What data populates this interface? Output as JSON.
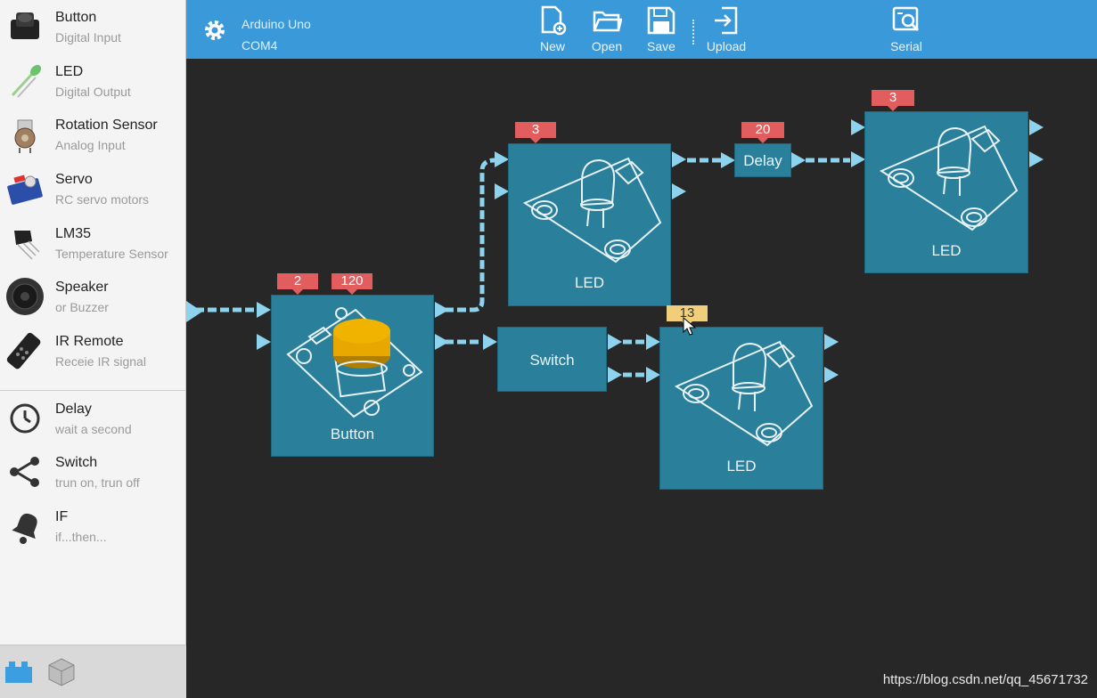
{
  "sidebar": {
    "items": [
      {
        "name": "Button",
        "desc": "Digital Input",
        "icon": "button-component-icon"
      },
      {
        "name": "LED",
        "desc": "Digital Output",
        "icon": "led-component-icon"
      },
      {
        "name": "Rotation Sensor",
        "desc": "Analog Input",
        "icon": "potentiometer-icon"
      },
      {
        "name": "Servo",
        "desc": "RC servo motors",
        "icon": "servo-icon"
      },
      {
        "name": "LM35",
        "desc": "Temperature Sensor",
        "icon": "lm35-icon"
      },
      {
        "name": "Speaker",
        "desc": "or Buzzer",
        "icon": "speaker-icon"
      },
      {
        "name": "IR Remote",
        "desc": "Receie IR signal",
        "icon": "ir-remote-icon"
      }
    ],
    "logic_items": [
      {
        "name": "Delay",
        "desc": "wait a second",
        "icon": "clock-icon"
      },
      {
        "name": "Switch",
        "desc": "trun on, trun off",
        "icon": "share-icon"
      },
      {
        "name": "IF",
        "desc": "if...then...",
        "icon": "bell-icon"
      }
    ],
    "bottom_tabs": [
      "blocks-icon",
      "cube-icon"
    ]
  },
  "toolbar": {
    "board": "Arduino Uno",
    "port": "COM4",
    "new_label": "New",
    "open_label": "Open",
    "save_label": "Save",
    "upload_label": "Upload",
    "serial_label": "Serial"
  },
  "canvas": {
    "button_block": {
      "title": "Button",
      "badge_pin": "2",
      "badge_value": "120"
    },
    "led_top": {
      "title": "LED",
      "badge": "3"
    },
    "delay_block": {
      "title": "Delay",
      "badge": "20"
    },
    "led_right": {
      "title": "LED",
      "badge": "3"
    },
    "switch_block": {
      "title": "Switch"
    },
    "led_bottom": {
      "title": "LED",
      "badge": "13"
    }
  },
  "watermark": "https://blog.csdn.net/qq_45671732",
  "colors": {
    "toolbar": "#3a99d8",
    "block": "#2a7f9b",
    "badge": "#e25d5d",
    "badge_highlight": "#f1cf7a",
    "wire": "#8ed3ee"
  }
}
